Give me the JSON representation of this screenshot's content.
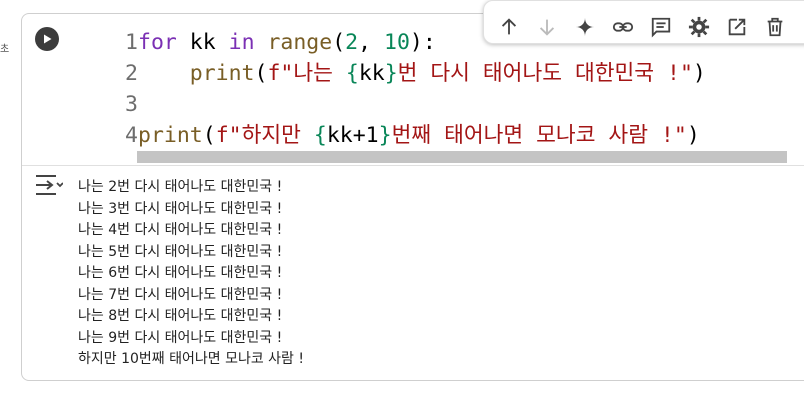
{
  "side_text": "초",
  "toolbar": {
    "icons": [
      "arrow-up-icon",
      "arrow-down-icon",
      "sparkle-icon",
      "link-icon",
      "comment-icon",
      "gear-icon",
      "open-in-editor-icon",
      "trash-icon",
      "more-vert-icon"
    ]
  },
  "code": {
    "lines": [
      {
        "num": "1",
        "tokens": [
          {
            "t": "for",
            "c": "kw"
          },
          {
            "t": " kk ",
            "c": "var"
          },
          {
            "t": "in",
            "c": "kw"
          },
          {
            "t": " ",
            "c": "var"
          },
          {
            "t": "range",
            "c": "fn"
          },
          {
            "t": "(",
            "c": "punct"
          },
          {
            "t": "2",
            "c": "num"
          },
          {
            "t": ", ",
            "c": "punct"
          },
          {
            "t": "10",
            "c": "num"
          },
          {
            "t": "):",
            "c": "punct"
          }
        ]
      },
      {
        "num": "2",
        "tokens": [
          {
            "t": "    ",
            "c": "var"
          },
          {
            "t": "print",
            "c": "fn"
          },
          {
            "t": "(",
            "c": "punct"
          },
          {
            "t": "f\"나는 ",
            "c": "str"
          },
          {
            "t": "{",
            "c": "brace"
          },
          {
            "t": "kk",
            "c": "var"
          },
          {
            "t": "}",
            "c": "brace"
          },
          {
            "t": "번 다시 태어나도 대한민국 !\"",
            "c": "str"
          },
          {
            "t": ")",
            "c": "punct"
          }
        ]
      },
      {
        "num": "3",
        "tokens": []
      },
      {
        "num": "4",
        "tokens": [
          {
            "t": "print",
            "c": "fn"
          },
          {
            "t": "(",
            "c": "punct"
          },
          {
            "t": "f\"하지만 ",
            "c": "str"
          },
          {
            "t": "{",
            "c": "brace"
          },
          {
            "t": "kk+1",
            "c": "var"
          },
          {
            "t": "}",
            "c": "brace"
          },
          {
            "t": "번째 태어나면 모나코 사람 !\"",
            "c": "str"
          },
          {
            "t": ")",
            "c": "punct"
          }
        ]
      }
    ]
  },
  "output": {
    "lines": [
      "나는 2번 다시 태어나도 대한민국 !",
      "나는 3번 다시 태어나도 대한민국 !",
      "나는 4번 다시 태어나도 대한민국 !",
      "나는 5번 다시 태어나도 대한민국 !",
      "나는 6번 다시 태어나도 대한민국 !",
      "나는 7번 다시 태어나도 대한민국 !",
      "나는 8번 다시 태어나도 대한민국 !",
      "나는 9번 다시 태어나도 대한민국 !",
      "하지만 10번째 태어나면 모나코 사람 !"
    ]
  },
  "colors": {
    "keyword": "#7b30b4",
    "function": "#795e26",
    "number": "#098658",
    "string": "#a31515"
  }
}
